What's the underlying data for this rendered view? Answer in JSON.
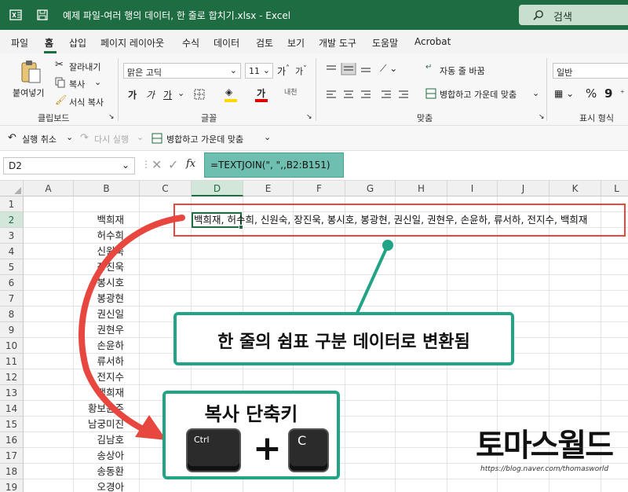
{
  "titlebar": {
    "title": "예제 파일-여러 행의 데이터, 한 줄로 합치기.xlsx  -  Excel",
    "search_label": "검색"
  },
  "menu": {
    "items": [
      "파일",
      "홈",
      "삽입",
      "페이지 레이아웃",
      "수식",
      "데이터",
      "검토",
      "보기",
      "개발 도구",
      "도움말",
      "Acrobat"
    ],
    "active": "홈"
  },
  "ribbon": {
    "paste": "붙여넣기",
    "cut": "잘라내기",
    "copy": "복사",
    "format_painter": "서식 복사",
    "clipboard_group": "클립보드",
    "font_name": "맑은 고딕",
    "font_size": "11",
    "bold": "가",
    "italic": "가",
    "underline": "가",
    "font_group": "글꼴",
    "wrap_text": "자동 줄 바꿈",
    "merge_center": "병합하고 가운데 맞춤",
    "align_group": "맞춤",
    "number_format": "일반",
    "number_group": "표시 형식",
    "text_color": "#e00000",
    "fill_color": "#ffd800"
  },
  "qat": {
    "undo": "실행 취소",
    "redo": "다시 실행",
    "merge_center": "병합하고 가운데 맞춤"
  },
  "formula_bar": {
    "name_box": "D2",
    "fx": "fx",
    "formula": "=TEXTJOIN(\", \",,B2:B151)"
  },
  "grid": {
    "columns": [
      "A",
      "B",
      "C",
      "D",
      "E",
      "F",
      "G",
      "H",
      "I",
      "J",
      "K",
      "L"
    ],
    "selected_column": "D",
    "rows": [
      "1",
      "2",
      "3",
      "4",
      "5",
      "6",
      "7",
      "8",
      "9",
      "10",
      "11",
      "12",
      "13",
      "14",
      "15",
      "16",
      "17",
      "18",
      "19"
    ],
    "selected_row": "2",
    "column_b": [
      "",
      "백희재",
      "허수희",
      "신원숙",
      "장진욱",
      "봉시호",
      "봉광현",
      "권신일",
      "권현우",
      "손윤하",
      "류서하",
      "전지수",
      "백희재",
      "황보윤주",
      "남궁미진",
      "김남호",
      "송상아",
      "송동환",
      "오경아"
    ],
    "d2_value": "백희재, 허수희, 신원숙, 장진욱, 봉시호, 봉광현, 권신일, 권현우, 손윤하, 류서하, 전지수, 백희재"
  },
  "annotations": {
    "callout_result": "한 줄의 쉼표 구분 데이터로 변환됨",
    "callout_copy": "복사 단축키",
    "key_ctrl": "Ctrl",
    "key_plus": "+",
    "key_c": "C",
    "brand": "토마스월드",
    "brand_url": "https://blog.naver.com/thomasworld",
    "accent_red": "#e8473f",
    "accent_teal": "#21a386"
  }
}
